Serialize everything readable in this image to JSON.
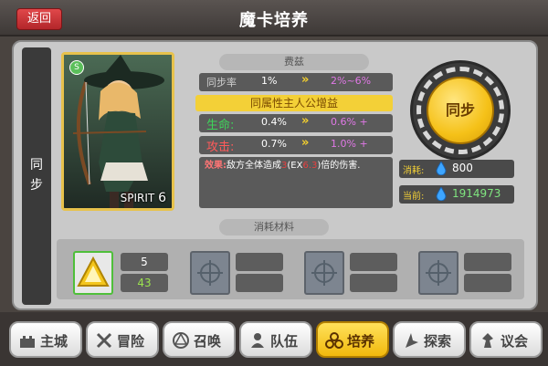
{
  "header": {
    "back_label": "返回",
    "title": "魔卡培养"
  },
  "side_tab": {
    "label": "同\n步"
  },
  "card": {
    "spirit_label": "SPIRIT",
    "spirit_value": "6",
    "badge": "S"
  },
  "fee": {
    "header": "费兹",
    "sync_rate": {
      "label": "同步率",
      "current": "1%",
      "next": "2%~6%"
    }
  },
  "bonus": {
    "header": "同属性主人公增益",
    "rows": [
      {
        "label": "生命:",
        "current": "0.4%",
        "next": "0.6% +",
        "color": "#3fd35a"
      },
      {
        "label": "攻击:",
        "current": "0.7%",
        "next": "1.0% +",
        "color": "#ff5a5a"
      }
    ],
    "effect": {
      "key": "效果:",
      "pre": "敌方全体造成",
      "v1": "3",
      "mid1": "(EX",
      "v2": "6.3",
      "post": ")倍的伤害."
    }
  },
  "sync": {
    "button_label": "同步",
    "cost_label": "消耗:",
    "cost_value": "800",
    "current_label": "当前:",
    "current_value": "1914973"
  },
  "materials": {
    "header": "消耗材料",
    "slots": [
      {
        "filled": true,
        "top": "5",
        "bottom": "43"
      },
      {
        "filled": false,
        "top": "",
        "bottom": ""
      },
      {
        "filled": false,
        "top": "",
        "bottom": ""
      },
      {
        "filled": false,
        "top": "",
        "bottom": ""
      }
    ]
  },
  "nav": [
    {
      "label": "主城",
      "icon": "castle-icon"
    },
    {
      "label": "冒险",
      "icon": "crossed-swords-icon"
    },
    {
      "label": "召唤",
      "icon": "summon-circle-icon"
    },
    {
      "label": "队伍",
      "icon": "team-icon"
    },
    {
      "label": "培养",
      "icon": "train-icon",
      "active": true
    },
    {
      "label": "探索",
      "icon": "explore-icon"
    },
    {
      "label": "议会",
      "icon": "council-icon"
    }
  ]
}
